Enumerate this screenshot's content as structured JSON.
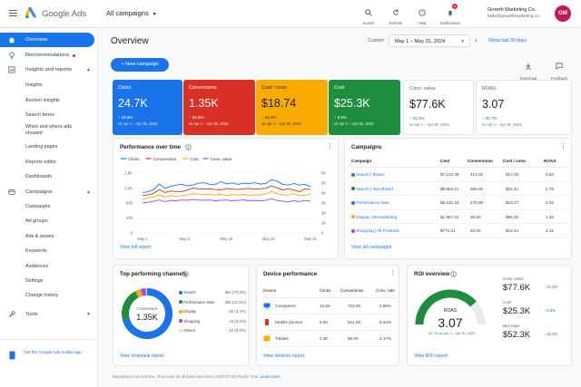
{
  "app": {
    "brand": "Google Ads",
    "campaign_selector": "All campaigns",
    "account_name": "Growth Marketing Co.",
    "account_email": "hello@growthmarketing.co",
    "avatar": "GM",
    "notif_count": "4"
  },
  "top_actions": [
    {
      "label": "Search",
      "icon": "search-icon"
    },
    {
      "label": "Refresh",
      "icon": "refresh-icon"
    },
    {
      "label": "Help",
      "icon": "help-icon"
    },
    {
      "label": "Notifications",
      "icon": "bell-icon"
    }
  ],
  "sidebar": {
    "items": [
      {
        "label": "Overview",
        "icon": "home-icon",
        "active": true
      },
      {
        "label": "Recommendations",
        "icon": "lightbulb-icon"
      },
      {
        "label": "Insights and reports",
        "icon": "chart-icon"
      }
    ],
    "insights_sub": [
      "Insights",
      "Auction insights",
      "Search terms",
      "When and where ads showed",
      "Landing pages",
      "Reports editor",
      "Dashboards"
    ],
    "campaigns_label": "Campaigns",
    "campaigns_sub": [
      "Campaigns",
      "Ad groups",
      "Ads & assets",
      "Keywords",
      "Audiences",
      "Settings",
      "Change history"
    ],
    "tools_label": "Tools",
    "mobile_app_link": "Get the Google Ads mobile app"
  },
  "header": {
    "title": "Overview",
    "custom_label": "Custom",
    "date_range": "May 1 – May 31, 2024",
    "last_30": "Show last 30 days",
    "new_campaign": "+ New campaign",
    "download": "Download",
    "feedback": "Feedback"
  },
  "kpis": [
    {
      "label": "Clicks",
      "value": "24.7K",
      "change": "↑ 18.6%",
      "sub": "vs Apr 1 – Apr 30, 2024",
      "color": "#1a73e8"
    },
    {
      "label": "Conversions",
      "value": "1.35K",
      "change": "↑ 24.5%",
      "sub": "vs Apr 1 – Apr 30, 2024",
      "color": "#d93025"
    },
    {
      "label": "Cost / conv.",
      "value": "$18.74",
      "change": "↓ 14.2%",
      "sub": "vs Apr 1 – Apr 30, 2024",
      "color": "#f9ab00"
    },
    {
      "label": "Cost",
      "value": "$25.3K",
      "change": "↑ 6.8%",
      "sub": "vs Apr 1 – Apr 30, 2024",
      "color": "#1e8e3e"
    },
    {
      "label": "Conv. value",
      "value": "$77.6K",
      "change": "↑ 31.2%",
      "sub": "vs Apr 1 – Apr 30, 2024",
      "color": "#ffffff"
    },
    {
      "label": "ROAS",
      "value": "3.07",
      "change": "↑ 30.7%",
      "sub": "vs Apr 1 – Apr 30, 2024",
      "color": "#ffffff"
    }
  ],
  "performance": {
    "title": "Performance over time",
    "view_link": "View full report",
    "chart_data": {
      "type": "line",
      "x": [
        "May 1",
        "May 6",
        "May 11",
        "May 16",
        "May 21",
        "May 26",
        "May 31"
      ],
      "x_ticks": [
        "May 1",
        "May 8",
        "May 15",
        "May 22",
        "May 31"
      ],
      "y_left_ticks": [
        "0",
        "400",
        "800",
        "1.2K",
        "1.6K"
      ],
      "y_right_ticks": [
        "0",
        "1K",
        "2K",
        "3K",
        "4K",
        "5K",
        "6K"
      ],
      "series": [
        {
          "name": "Clicks",
          "color": "#1a73e8",
          "values": [
            1080,
            1100,
            1160,
            1310,
            1190,
            1250,
            1280,
            1300,
            1260,
            1280,
            1330,
            1340,
            1300,
            1290,
            1370,
            1310,
            1340,
            1300,
            1330,
            1320,
            1340,
            1310,
            1320,
            1420,
            1390,
            1300,
            1280,
            1320,
            1280,
            1300,
            1240
          ]
        },
        {
          "name": "Conversions",
          "color": "#d93025",
          "values": [
            1000,
            1020,
            1060,
            1160,
            1080,
            1120,
            1110,
            1100,
            1150,
            1200,
            1180,
            1170,
            1180,
            1160,
            1150,
            1190,
            1170,
            1160,
            1180,
            1190,
            1170,
            1180,
            1190,
            1260,
            1210,
            1150,
            1180,
            1150,
            1100,
            1180,
            1160
          ]
        },
        {
          "name": "Cost",
          "color": "#f9ab00",
          "values": [
            900,
            940,
            960,
            1020,
            960,
            1000,
            980,
            1000,
            1020,
            1050,
            1040,
            1020,
            1030,
            1010,
            1040,
            1000,
            1030,
            1010,
            1030,
            1000,
            1020,
            1010,
            1040,
            1110,
            1050,
            1020,
            1010,
            1050,
            1000,
            1010,
            1030
          ]
        },
        {
          "name": "Conv. value",
          "color": "#a142f4",
          "values": [
            800,
            820,
            850,
            880,
            840,
            870,
            860,
            880,
            870,
            900,
            880,
            870,
            880,
            860,
            870,
            880,
            860,
            870,
            880,
            860,
            870,
            860,
            870,
            920,
            870,
            850,
            830,
            860,
            840,
            870,
            850
          ]
        }
      ]
    }
  },
  "campaigns": {
    "title": "Campaigns",
    "columns": [
      "Campaign",
      "Cost",
      "Conversions",
      "Cost / conv.",
      "ROAS"
    ],
    "rows": [
      {
        "name": "Search | Brand",
        "cost": "$7,122.45",
        "conv": "412.00",
        "cpc": "$17.29",
        "roas": "3.64",
        "color": "#1a73e8"
      },
      {
        "name": "Search | Non-Brand",
        "cost": "$8,984.21",
        "conv": "368.00",
        "cpc": "$24.41",
        "roas": "2.75",
        "color": "#1e8e3e"
      },
      {
        "name": "Performance Max",
        "cost": "$6,421.33",
        "conv": "276.00",
        "cpc": "$23.27",
        "roas": "3.02",
        "color": "#1a73e8"
      },
      {
        "name": "Display | Remarketing",
        "cost": "$1,987.22",
        "conv": "36.00",
        "cpc": "$55.20",
        "roas": "1.45",
        "color": "#f9ab00"
      },
      {
        "name": "Shopping | All Products",
        "cost": "$771.21",
        "conv": "62.00",
        "cpc": "$12.44",
        "roas": "4.11",
        "color": "#a142f4"
      }
    ],
    "view_link": "View all campaigns"
  },
  "channels": {
    "title": "Top performing channels",
    "center_label": "Conversions",
    "center_value": "1.35K",
    "chart_data": {
      "type": "pie",
      "categories": [
        "Search",
        "Performance Max",
        "Display",
        "Shopping",
        "Others"
      ],
      "values": [
        70.8,
        21.5,
        3.7,
        3.2,
        0.8
      ],
      "labels": [
        "950 (70.8%)",
        "285 (21.5%)",
        "50 (3.7%)",
        "43 (3.2%)",
        "12 (0.8%)"
      ],
      "colors": [
        "#1a73e8",
        "#1e8e3e",
        "#f9ab00",
        "#a142f4",
        "#dadce0"
      ]
    },
    "view_link": "View channels report"
  },
  "devices": {
    "title": "Device performance",
    "columns": [
      "Device",
      "Clicks",
      "Conversions",
      "Conv. rate"
    ],
    "rows": [
      {
        "name": "Computers",
        "icon": "computer-icon",
        "clicks": "12.6K",
        "conv": "742.00",
        "rate": "5.88%"
      },
      {
        "name": "Mobile phones",
        "icon": "phone-icon",
        "clicks": "9.8K",
        "conv": "512.00",
        "rate": "5.22%"
      },
      {
        "name": "Tablets",
        "icon": "tablet-icon",
        "clicks": "2.3K",
        "conv": "96.00",
        "rate": "4.17%"
      }
    ],
    "view_link": "View devices report"
  },
  "roi": {
    "title": "ROI overview",
    "gauge_label": "ROAS",
    "gauge_value": "3.07",
    "gauge_fraction": 0.77,
    "gauge_change": "↑ 30.7% vs Apr 1 – Apr 30, 2024",
    "stats": [
      {
        "label": "Conv. value",
        "value": "$77.6K",
        "change": "↑ 31.2%"
      },
      {
        "label": "Cost",
        "value": "$25.3K",
        "change": "↑ 6.8%"
      },
      {
        "label": "Net value",
        "value": "$52.3K",
        "change": "↑ 46.4%"
      }
    ],
    "view_link": "View ROI report"
  },
  "footer": {
    "note": "Reporting is not real-time. Time zone for all dates and times: (GMT-07:00) Pacific Time.",
    "learn_more": "Learn more"
  }
}
